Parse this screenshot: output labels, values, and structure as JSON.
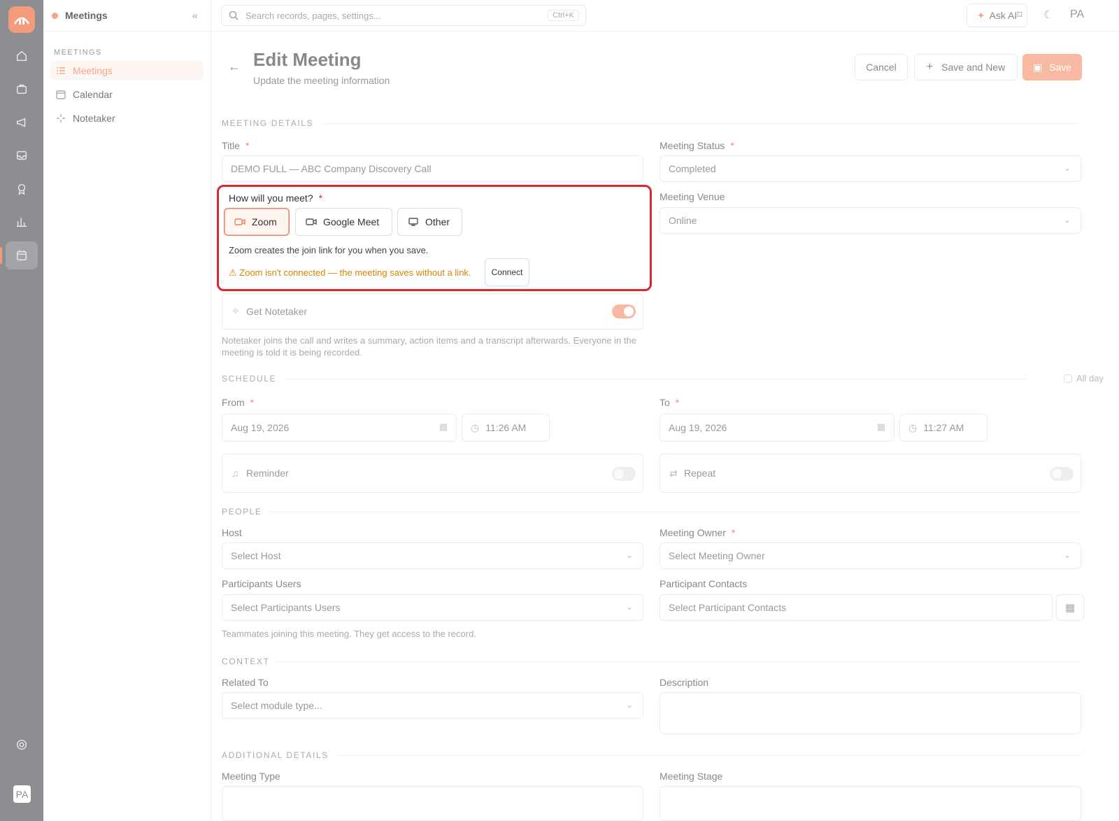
{
  "rail": {
    "icons": [
      "home-icon",
      "briefcase-icon",
      "megaphone-icon",
      "inbox-icon",
      "award-icon",
      "bar-chart-icon",
      "calendar-icon",
      "settings-icon"
    ],
    "avatar": "PA"
  },
  "subnav": {
    "title": "Meetings",
    "section": "MEETINGS",
    "items": [
      {
        "label": "Meetings"
      },
      {
        "label": "Calendar"
      },
      {
        "label": "Notetaker"
      }
    ]
  },
  "topbar": {
    "search_placeholder": "Search records, pages, settings...",
    "shortcut": "Ctrl+K",
    "ask_ai": "Ask AI",
    "avatar": "PA"
  },
  "header": {
    "title": "Edit Meeting",
    "subtitle": "Update the meeting information",
    "cancel": "Cancel",
    "save_new": "Save and New",
    "save": "Save"
  },
  "sections": {
    "details": "MEETING DETAILS",
    "schedule": "SCHEDULE",
    "people": "PEOPLE",
    "context": "CONTEXT",
    "additional": "ADDITIONAL DETAILS"
  },
  "details": {
    "title_label": "Title",
    "title_value": "DEMO FULL — ABC Company Discovery Call",
    "status_label": "Meeting Status",
    "status_value": "Completed",
    "venue_label": "Meeting Venue",
    "venue_value": "Online"
  },
  "meet": {
    "label": "How will you meet?",
    "options": [
      {
        "label": "Zoom"
      },
      {
        "label": "Google Meet"
      },
      {
        "label": "Other"
      }
    ],
    "help": "Zoom creates the join link for you when you save.",
    "warning": "Zoom isn't connected — the meeting saves without a link.",
    "connect": "Connect"
  },
  "notetaker": {
    "label": "Get Notetaker",
    "enabled": true,
    "help": "Notetaker joins the call and writes a summary, action items and a transcript afterwards. Everyone in the meeting is told it is being recorded."
  },
  "schedule": {
    "all_day": "All day",
    "from_label": "From",
    "from_date": "Aug 19, 2026",
    "from_time": "11:26 AM",
    "to_label": "To",
    "to_date": "Aug 19, 2026",
    "to_time": "11:27 AM",
    "reminder": "Reminder",
    "repeat": "Repeat"
  },
  "people": {
    "host_label": "Host",
    "host_placeholder": "Select Host",
    "owner_label": "Meeting Owner",
    "owner_placeholder": "Select Meeting Owner",
    "participants_label": "Participants Users",
    "participants_placeholder": "Select Participants Users",
    "contacts_label": "Participant Contacts",
    "contacts_placeholder": "Select Participant Contacts",
    "help": "Teammates joining this meeting. They get access to the record."
  },
  "context": {
    "related_label": "Related To",
    "related_placeholder": "Select module type...",
    "description_label": "Description"
  },
  "additional": {
    "type_label": "Meeting Type",
    "stage_label": "Meeting Stage"
  }
}
